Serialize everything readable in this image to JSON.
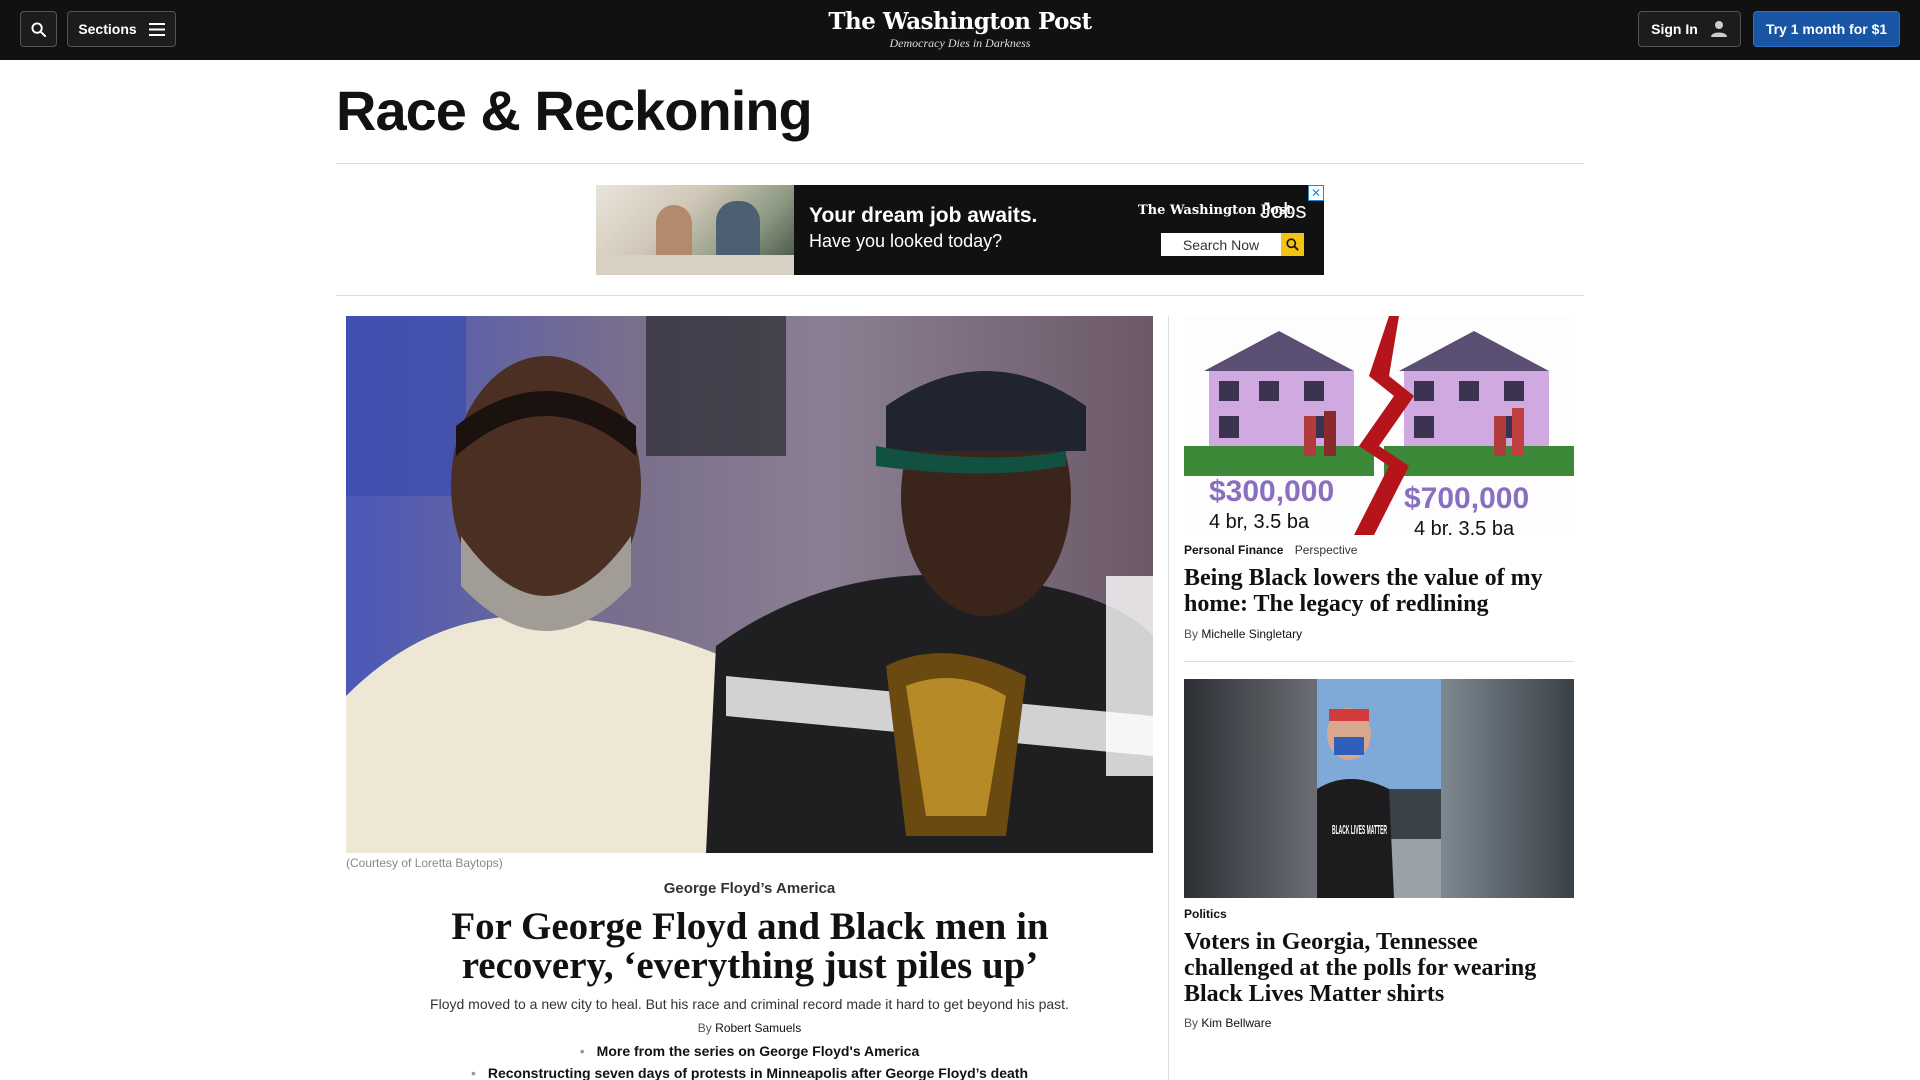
{
  "nav": {
    "sections_label": "Sections",
    "logo": "The Washington Post",
    "tagline": "Democracy Dies in Darkness",
    "signin_label": "Sign In",
    "subscribe_label": "Try 1 month for $1"
  },
  "page": {
    "title": "Race & Reckoning"
  },
  "ad": {
    "headline": "Your dream job awaits.",
    "subhead": "Have you looked today?",
    "brand": "The Washington Post",
    "product": "Jobs",
    "search_label": "Search Now"
  },
  "main_story": {
    "image_credit": "(Courtesy of Loretta Baytops)",
    "kicker": "George Floyd’s America",
    "headline": "For George Floyd and Black men in recovery, ‘everything just piles up’",
    "blurb": "Floyd moved to a new city to heal. But his race and criminal record made it hard to get beyond his past.",
    "byline_prefix": "By",
    "author": "Robert Samuels",
    "related": [
      "More from the series on George Floyd's America",
      "Reconstructing seven days of protests in Minneapolis after George Floyd’s death"
    ]
  },
  "rail": [
    {
      "image_text": {
        "price_left": "$300,000",
        "rooms_left": "4 br, 3.5 ba",
        "price_right": "$700,000",
        "rooms_right": "4 br, 3.5 ba"
      },
      "section": "Personal Finance",
      "label": "Perspective",
      "headline": "Being Black lowers the value of my home: The legacy of redlining",
      "byline_prefix": "By",
      "author": "Michelle Singletary"
    },
    {
      "image_text": {
        "shirt": "BLACK LIVES MATTER"
      },
      "section": "Politics",
      "label": "",
      "headline": "Voters in Georgia, Tennessee challenged at the polls for wearing Black Lives Matter shirts",
      "byline_prefix": "By",
      "author": "Kim Bellware"
    }
  ],
  "icons": {
    "search": "search-icon",
    "menu": "hamburger-icon",
    "user": "user-icon",
    "ad_close": "ad-choices-icon",
    "ad_search": "magnifier-icon"
  },
  "colors": {
    "nav_bg": "#111111",
    "subscribe_bg": "#1955a5",
    "ad_button": "#f2c313"
  }
}
